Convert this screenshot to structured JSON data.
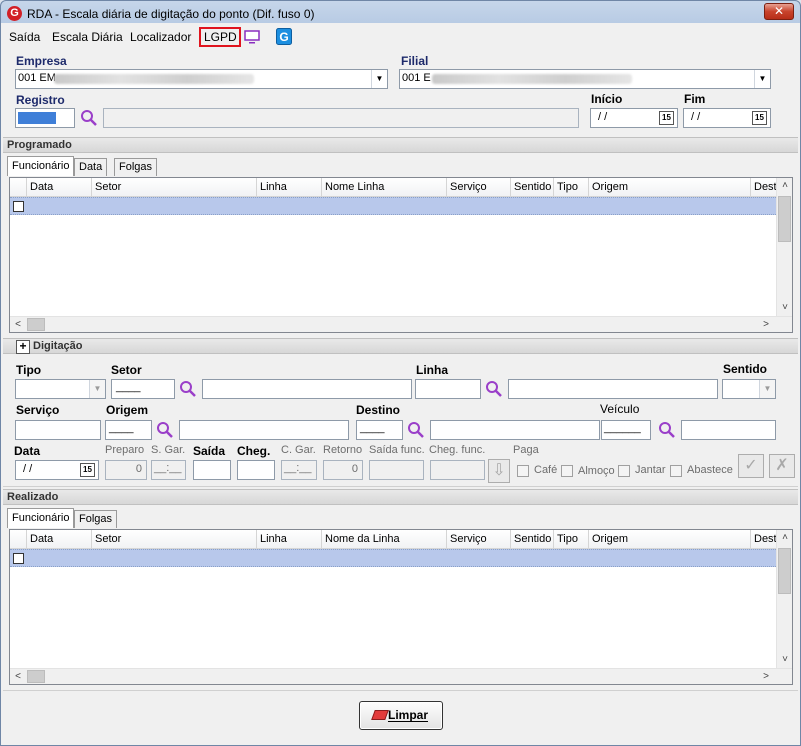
{
  "window": {
    "title": "RDA - Escala diária de digitação do ponto (Dif. fuso 0)",
    "app_icon": "G",
    "close_glyph": "✕"
  },
  "menu": {
    "items": [
      "Saída",
      "Escala Diária",
      "Localizador",
      "LGPD"
    ],
    "highlight_color": "#e0141e"
  },
  "header": {
    "empresa_label": "Empresa",
    "empresa_value": "001 EM",
    "filial_label": "Filial",
    "filial_value": "001 E",
    "registro_label": "Registro",
    "inicio_label": "Início",
    "inicio_value": " / /",
    "fim_label": "Fim",
    "fim_value": " / /",
    "calendar_glyph": "15"
  },
  "programado": {
    "section_title": "Programado",
    "tabs": [
      "Funcionário",
      "Data",
      "Folgas"
    ],
    "columns": [
      "Data",
      "Setor",
      "Linha",
      "Nome Linha",
      "Serviço",
      "Sentido",
      "Tipo",
      "Origem",
      "Dest"
    ]
  },
  "digitacao": {
    "section_title": "Digitação",
    "expand_glyph": "+",
    "tipo_label": "Tipo",
    "setor_label": "Setor",
    "linha_label": "Linha",
    "sentido_label": "Sentido",
    "servico_label": "Serviço",
    "origem_label": "Origem",
    "destino_label": "Destino",
    "veiculo_label": "Veículo",
    "data_label": "Data",
    "data_value": " / /",
    "preparo_label": "Preparo",
    "preparo_value": "0",
    "sgar_label": "S. Gar.",
    "sgar_value": "__:__",
    "saida_label": "Saída",
    "cheg_label": "Cheg.",
    "cgar_label": "C. Gar.",
    "cgar_value": "__:__",
    "retorno_label": "Retorno",
    "retorno_value": "0",
    "saida_func_label": "Saída func.",
    "cheg_func_label": "Cheg. func.",
    "paga_label": "Paga",
    "checks": [
      "Café",
      "Almoço",
      "Jantar",
      "Abastece"
    ],
    "setor_mask": "____",
    "origem_mask": "____",
    "destino_mask": "____",
    "veiculo_mask": "______"
  },
  "realizado": {
    "section_title": "Realizado",
    "tabs": [
      "Funcionário",
      "Folgas"
    ],
    "columns": [
      "Data",
      "Setor",
      "Linha",
      "Nome da Linha",
      "Serviço",
      "Sentido",
      "Tipo",
      "Origem",
      "Dest"
    ]
  },
  "footer": {
    "limpar_label": "Limpar"
  },
  "colors": {
    "selection_row": "#b8c8eb",
    "registro_fill": "#3f7fd8",
    "magnifier": "#9a3fc9"
  }
}
